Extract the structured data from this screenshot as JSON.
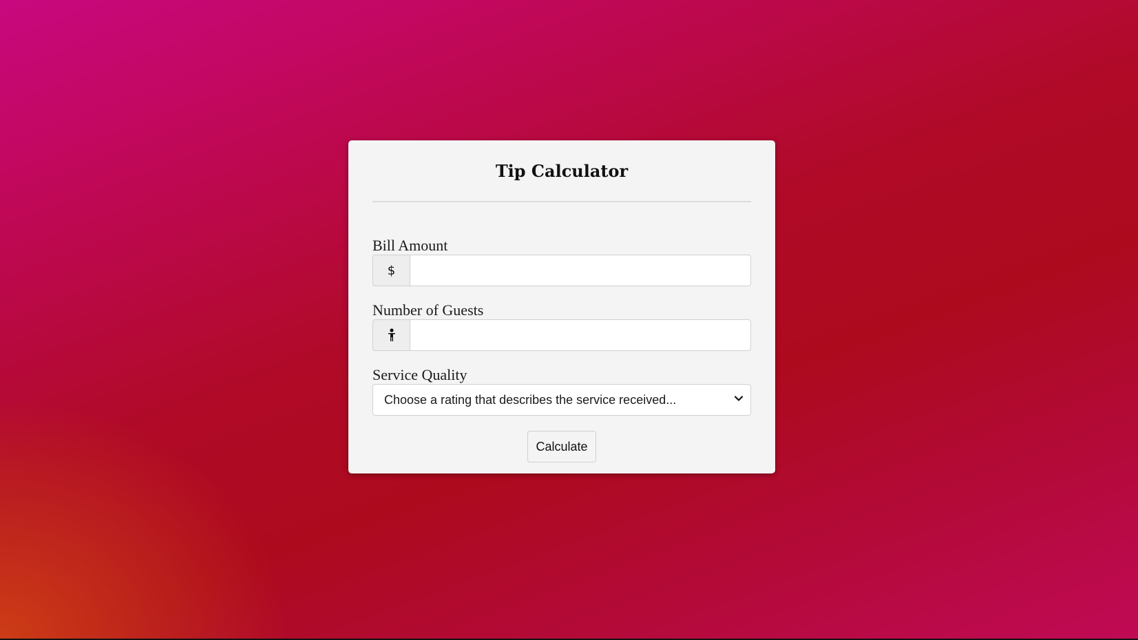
{
  "page": {
    "title": "Tip Calculator"
  },
  "fields": {
    "bill": {
      "label": "Bill Amount",
      "addon": "$",
      "value": ""
    },
    "guests": {
      "label": "Number of Guests",
      "addon_icon": "person-icon",
      "value": ""
    },
    "service": {
      "label": "Service Quality",
      "selected": "Choose a rating that describes the service received..."
    }
  },
  "actions": {
    "calculate_label": "Calculate"
  },
  "colors": {
    "background_top": "#c8087f",
    "background_mid": "#ad0a1e",
    "background_corner": "#c84a14",
    "card": "#f4f4f4"
  }
}
